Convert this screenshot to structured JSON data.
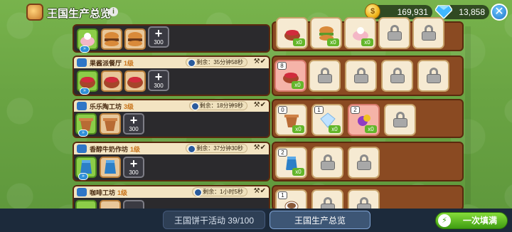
{
  "header": {
    "title": "王国生产总览",
    "info_glyph": "i",
    "coins": "169,931",
    "gems": "13,858",
    "close_glyph": "✕"
  },
  "workshops": [
    {
      "name": "",
      "level": "",
      "remaining": "",
      "add_cost": "300"
    },
    {
      "name": "果酱派餐厅",
      "level": "1级",
      "remaining": "剩余：35分钟58秒",
      "add_cost": "300"
    },
    {
      "name": "乐乐陶工坊",
      "level": "3级",
      "remaining": "剩余：18分钟9秒",
      "add_cost": "300"
    },
    {
      "name": "香醇牛奶作坊",
      "level": "1级",
      "remaining": "剩余：37分钟30秒",
      "add_cost": "300"
    },
    {
      "name": "咖啡工坊",
      "level": "1级",
      "remaining": "剩余：1小时5秒",
      "add_cost": ""
    }
  ],
  "products": {
    "row1": [
      "x0",
      "x0",
      "x0"
    ],
    "row2_count": "8",
    "row2_x": "x0",
    "row3": [
      {
        "count": "0",
        "x": "x0"
      },
      {
        "count": "1",
        "x": "x0"
      },
      {
        "count": "2",
        "x": "x0"
      }
    ],
    "row4": {
      "count": "2",
      "x": "x0"
    },
    "row5_count": "1"
  },
  "bottom": {
    "tab_event": "王国饼干活动 39/100",
    "tab_overview": "王国生产总览",
    "fill_all": "一次填满"
  },
  "colors": {
    "panel_brown": "#8a4a22",
    "fill_green": "#4fae17",
    "accent_blue": "#2f8fd8"
  }
}
